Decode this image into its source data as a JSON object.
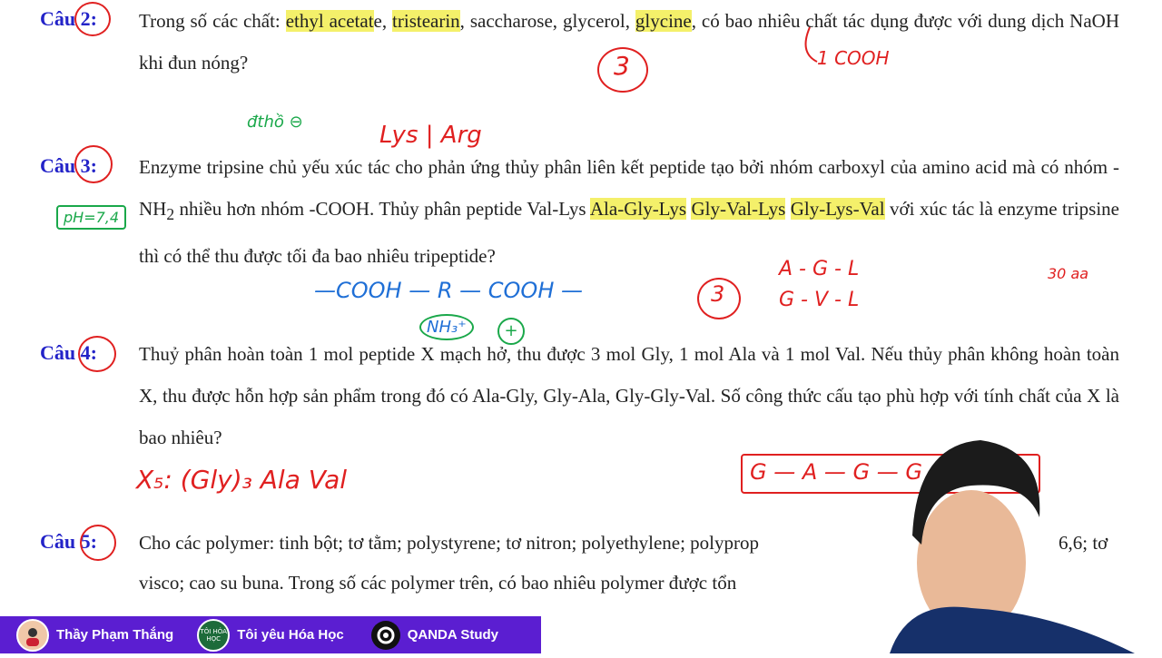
{
  "questions": [
    {
      "label": "Câu 2:",
      "parts": [
        "Trong số các chất: ",
        "ethyl acetat",
        "e, ",
        "tristearin",
        ", saccharose, glycerol, ",
        "glycine",
        ", có bao nhiêu chất tác dụng được với dung dịch NaOH khi đun nóng?"
      ]
    },
    {
      "label": "Câu 3:",
      "parts": [
        "Enzyme tripsine chủ yếu xúc tác cho phản ứng thủy phân liên kết peptide tạo bởi nhóm carboxyl của amino acid mà có nhóm -NH",
        "2",
        " nhiều hơn nhóm -COOH. Thủy phân peptide Val-Lys ",
        "Ala-Gly-Lys",
        " ",
        "Gly-Val-Lys",
        " ",
        "Gly-Lys-Val",
        " với xúc tác là enzyme tripsine thì có thể thu được tối đa bao nhiêu tripeptide?"
      ]
    },
    {
      "label": "Câu 4:",
      "text": "Thuỷ phân hoàn toàn 1 mol peptide X mạch hở, thu được 3 mol Gly, 1 mol Ala và 1 mol Val. Nếu thủy phân không hoàn toàn X, thu được hỗn hợp sản phẩm trong đó có Ala-Gly, Gly-Ala, Gly-Gly-Val. Số công thức cấu tạo phù hợp với tính chất của X là bao nhiêu?"
    },
    {
      "label": "Câu 5:",
      "text": "Cho các polymer: tinh bột; tơ tằm; polystyrene; tơ nitron; polyethylene; polyprop",
      "text_tail": "6,6; tơ",
      "text2": "visco; cao su buna. Trong số các polymer trên, có bao nhiêu polymer được tổn"
    }
  ],
  "annotations": {
    "q2_answer": "3",
    "q2_note": "1 COOH",
    "q3_note1": "đthồ ⊖",
    "q3_note2": "Lys | Arg",
    "q3_ph": "pH=7,4",
    "q3_chain": "—COOH — R — COOH —",
    "q3_nh": "NH₃⁺",
    "q3_plus": "+",
    "q3_answer": "3",
    "q3_list1": "A - G - L",
    "q3_list2": "G - V - L",
    "q3_side": "30 aa",
    "q4_formula": "X₅: (Gly)₃ Ala Val",
    "q4_box": "G — A — G — G"
  },
  "bottom_bar": {
    "items": [
      {
        "name": "Thầy Phạm Thắng",
        "icon": "person-avatar-icon"
      },
      {
        "name": "Tôi yêu Hóa Học",
        "icon": "chemistry-badge-icon",
        "badge": "TÔI HÓA HỌC"
      },
      {
        "name": "QANDA Study",
        "icon": "qanda-logo-icon"
      }
    ],
    "color": "#5b1ed1"
  }
}
